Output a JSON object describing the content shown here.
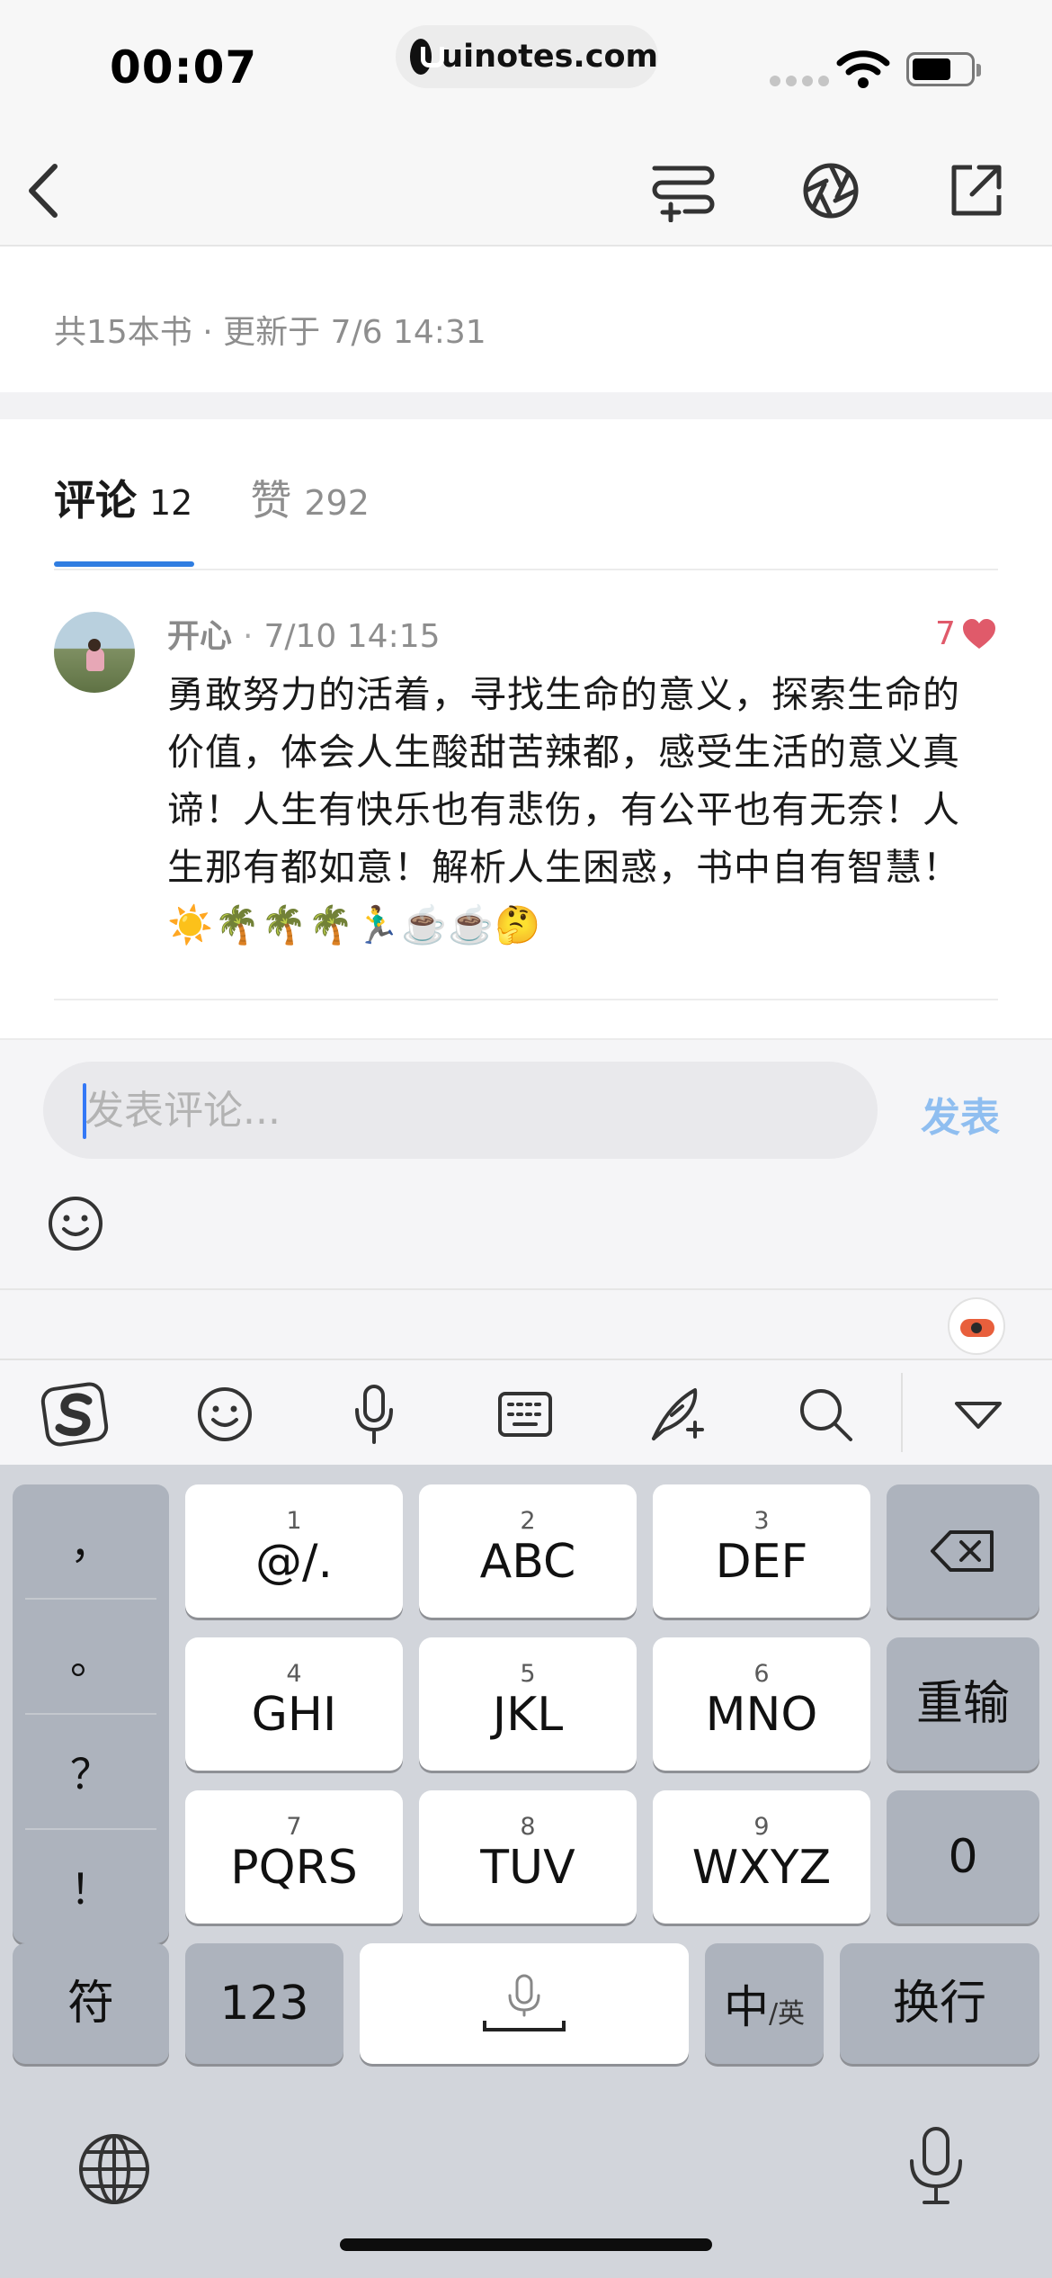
{
  "status_bar": {
    "time": "00:07",
    "url": "uinotes.com",
    "icons": [
      "signal-dots-icon",
      "wifi-icon",
      "battery-icon"
    ]
  },
  "nav": {
    "icons": [
      "back-icon",
      "add-to-list-icon",
      "shutter-icon",
      "share-icon"
    ]
  },
  "booklist": {
    "meta": "共15本书 · 更新于 7/6 14:31"
  },
  "tabs": [
    {
      "title": "评论",
      "count": "12",
      "active": true
    },
    {
      "title": "赞",
      "count": "292",
      "active": false
    }
  ],
  "comment": {
    "user": "开心",
    "separator": "·",
    "time": "7/10 14:15",
    "likes": "7",
    "text": "勇敢努力的活着，寻找生命的意义，探索生命的价值，体会人生酸甜苦辣都，感受生活的意义真谛！人生有快乐也有悲伤，有公平也有无奈！人生那有都如意！解析人生困惑，书中自有智慧！☀️🌴🌴🌴🏃‍♂️☕️☕️🤔"
  },
  "composer": {
    "placeholder": "发表评论...",
    "value": "",
    "send_label": "发表"
  },
  "ime_toolbar": {
    "icons": [
      "sogou-logo-icon",
      "emoji-icon",
      "microphone-icon",
      "keyboard-icon",
      "handwriting-icon",
      "search-icon",
      "collapse-keyboard-icon"
    ]
  },
  "keyboard": {
    "punctuation": [
      "，",
      "。",
      "？",
      "！"
    ],
    "keys": [
      {
        "num": "1",
        "label": "@/."
      },
      {
        "num": "2",
        "label": "ABC"
      },
      {
        "num": "3",
        "label": "DEF"
      },
      {
        "num": "4",
        "label": "GHI"
      },
      {
        "num": "5",
        "label": "JKL"
      },
      {
        "num": "6",
        "label": "MNO"
      },
      {
        "num": "7",
        "label": "PQRS"
      },
      {
        "num": "8",
        "label": "TUV"
      },
      {
        "num": "9",
        "label": "WXYZ"
      }
    ],
    "reenter_label": "重输",
    "zero_label": "0",
    "symbol_label": "符",
    "numbers_label": "123",
    "lang_main": "中",
    "lang_sub": "/英",
    "newline_label": "换行"
  },
  "colors": {
    "accent": "#2f7de1",
    "like": "#e05a6a",
    "send_disabled": "#8fbef0",
    "keyboard_bg": "#d2d5db"
  }
}
